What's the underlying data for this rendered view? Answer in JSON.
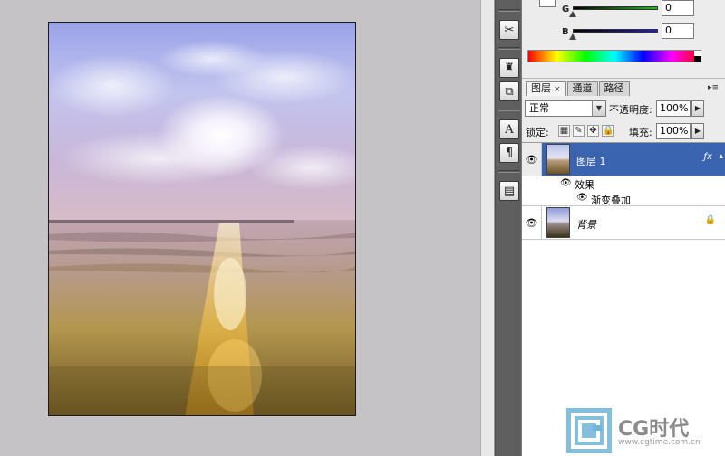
{
  "color_panel": {
    "channels": [
      {
        "label": "G",
        "value": "0",
        "color": "#22bb22"
      },
      {
        "label": "B",
        "value": "0",
        "color": "#1e1ed0"
      }
    ]
  },
  "layers_panel": {
    "tabs": [
      {
        "label": "图层",
        "active": true,
        "closable": true
      },
      {
        "label": "通道",
        "active": false
      },
      {
        "label": "路径",
        "active": false
      }
    ],
    "close_glyph": "×",
    "blend_mode": "正常",
    "opacity_label": "不透明度:",
    "opacity_value": "100%",
    "lock_label": "锁定:",
    "fill_label": "填充:",
    "fill_value": "100%",
    "layers": [
      {
        "name": "图层 1",
        "selected": true,
        "visible": true,
        "has_fx": true
      },
      {
        "name": "背景",
        "selected": false,
        "visible": true,
        "locked": true
      }
    ],
    "effects_label": "效果",
    "effect_items": [
      "渐变叠加"
    ]
  },
  "watermark": {
    "title": "CG时代",
    "url": "www.cgtime.com.cn"
  },
  "icons": [
    "scissors-icon",
    "stamp-icon",
    "copy-icon",
    "text-icon",
    "paragraph-icon",
    "note-icon",
    "eye-icon",
    "fx-icon",
    "lock-icon"
  ],
  "colors": {
    "selected_layer": "#3a64b0",
    "dock": "#5f5f5f",
    "canvas_bg": "#c5c3c6"
  }
}
